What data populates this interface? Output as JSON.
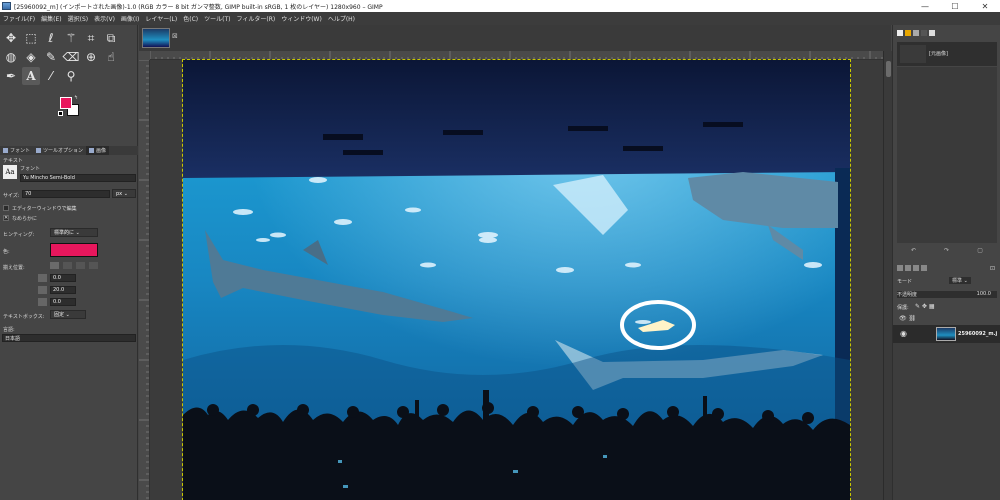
{
  "window": {
    "title": "[25960092_m] (インポートされた画像)-1.0 (RGB カラー 8 bit ガンマ整数, GIMP built-in sRGB, 1 枚のレイヤー) 1280x960 – GIMP",
    "minimize": "—",
    "maximize": "☐",
    "close": "✕"
  },
  "menu": [
    "ファイル(F)",
    "編集(E)",
    "選択(S)",
    "表示(V)",
    "画像(I)",
    "レイヤー(L)",
    "色(C)",
    "ツール(T)",
    "フィルター(R)",
    "ウィンドウ(W)",
    "ヘルプ(H)"
  ],
  "tools": [
    {
      "name": "move-tool-icon",
      "glyph": "✥"
    },
    {
      "name": "rect-select-tool-icon",
      "glyph": "⬚"
    },
    {
      "name": "lasso-tool-icon",
      "glyph": "ℓ"
    },
    {
      "name": "fuzzy-select-tool-icon",
      "glyph": "⚚"
    },
    {
      "name": "crop-tool-icon",
      "glyph": "⌗"
    },
    {
      "name": "unified-transform-tool-icon",
      "glyph": "⧉"
    },
    {
      "name": "warp-transform-tool-icon",
      "glyph": "◍"
    },
    {
      "name": "bucket-fill-tool-icon",
      "glyph": "◈"
    },
    {
      "name": "paintbrush-tool-icon",
      "glyph": "✎"
    },
    {
      "name": "eraser-tool-icon",
      "glyph": "⌫"
    },
    {
      "name": "clone-tool-icon",
      "glyph": "⊕"
    },
    {
      "name": "smudge-tool-icon",
      "glyph": "☝"
    },
    {
      "name": "paths-tool-icon",
      "glyph": "✒"
    },
    {
      "name": "text-tool-icon",
      "glyph": "A"
    },
    {
      "name": "color-picker-tool-icon",
      "glyph": "⁄"
    },
    {
      "name": "zoom-tool-icon",
      "glyph": "⚲"
    }
  ],
  "colors": {
    "foreground": "#e8175d",
    "background": "#ffffff"
  },
  "tool_options": {
    "tabs": [
      "フォント",
      "ツールオプション",
      "画像"
    ],
    "section_title": "テキスト",
    "font_label": "フォント",
    "font_value": "Yu Mincho Semi-Bold",
    "size_label": "サイズ:",
    "size_value": "70",
    "size_unit": "px",
    "use_editor": "エディターウィンドウで編集",
    "antialias": "なめらかに",
    "hinting_label": "ヒンティング:",
    "hinting_value": "標準的に",
    "color_label": "色:",
    "justify_label": "揃え位置:",
    "indent_value": "0.0",
    "line_spacing_value": "20.0",
    "letter_spacing_value": "0.0",
    "box_label": "テキストボックス:",
    "box_value": "固定",
    "language_label": "言語:",
    "language_value": "日本語",
    "text_color": "#e8175d"
  },
  "dock": {
    "image_label": "[元画像]",
    "mode_label": "モード",
    "mode_value": "標準",
    "opacity_label": "不透明度",
    "opacity_value": "100.0",
    "lock_label": "保護:",
    "layer_name": "25960092_m.j"
  },
  "icons": {
    "layer_visibility": "eye-icon",
    "undo": "undo-icon",
    "redo": "redo-icon"
  },
  "annotation_color": "#ffffff"
}
